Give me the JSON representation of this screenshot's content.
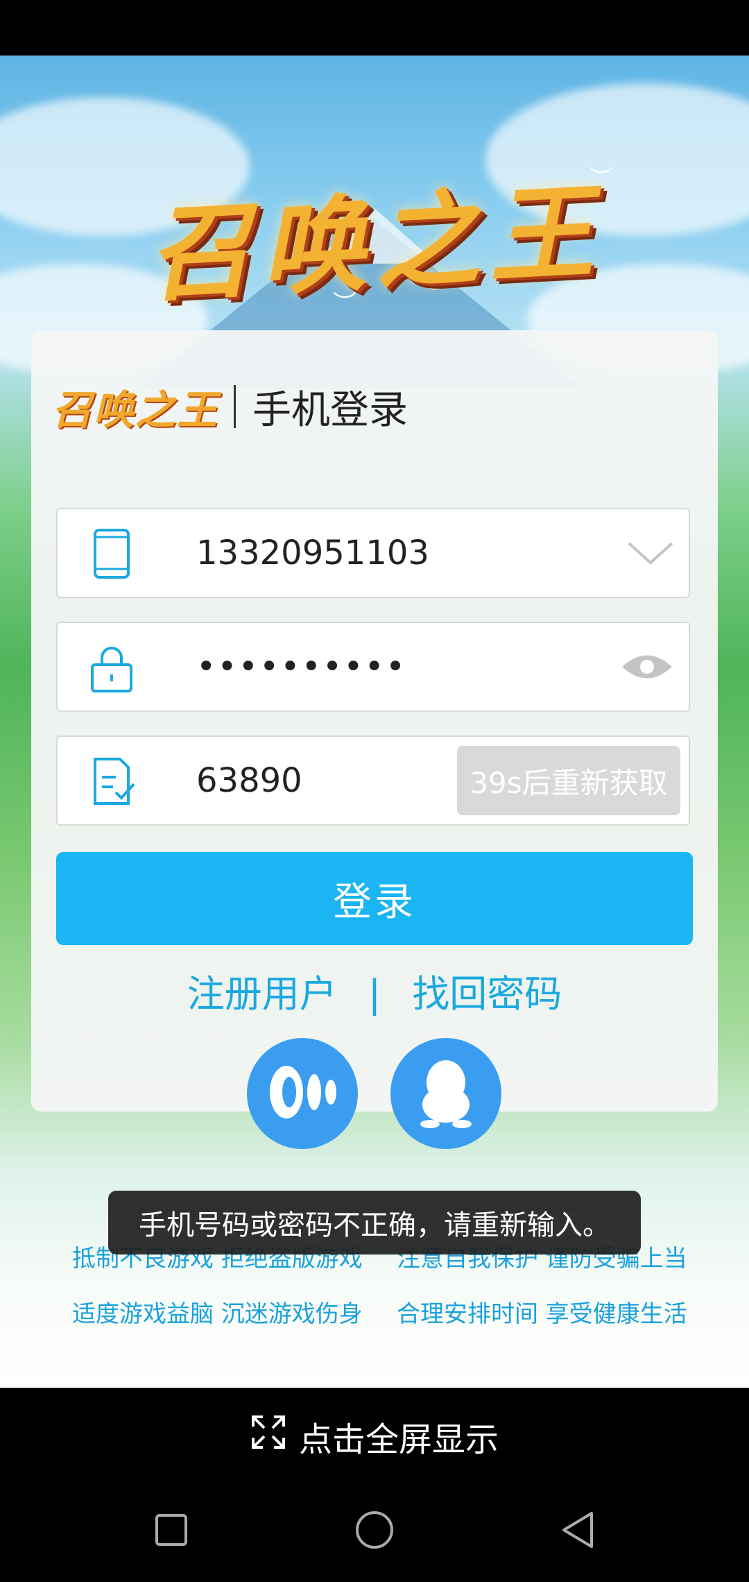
{
  "game": {
    "logo_text": "召唤之王"
  },
  "login": {
    "header_logo": "召唤之王",
    "title": "手机登录",
    "phone_value": "13320951103",
    "password_value": "••••••••••",
    "code_value": "63890",
    "resend_label": "39s后重新获取",
    "login_label": "登录",
    "register_label": "注册用户",
    "link_separator": "|",
    "recover_label": "找回密码",
    "social": [
      "speaker-app-icon",
      "qq-penguin-icon"
    ]
  },
  "toast": {
    "message": "手机号码或密码不正确，请重新输入。"
  },
  "advice": {
    "line1_left": "抵制不良游戏 拒绝盗版游戏",
    "line1_right": "注意自我保护 谨防受骗上当",
    "line2_left": "适度游戏益脑 沉迷游戏伤身",
    "line2_right": "合理安排时间 享受健康生活"
  },
  "bottom": {
    "fullscreen_label": "点击全屏显示"
  },
  "colors": {
    "accent": "#1ab5f2",
    "link": "#1aa8e0",
    "social_bg": "#3a9df0"
  }
}
